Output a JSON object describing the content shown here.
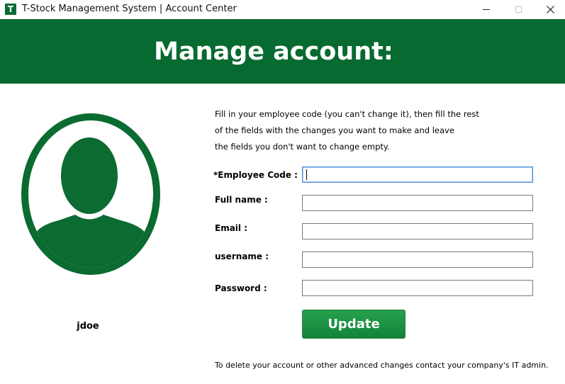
{
  "window": {
    "icon_letter": "T",
    "title": "T-Stock Management System | Account Center",
    "controls": {
      "minimize": "minimize",
      "maximize": "maximize",
      "close": "✕"
    }
  },
  "header": {
    "title": "Manage account:"
  },
  "profile": {
    "username": "jdoe",
    "avatar_icon": "user-silhouette-icon"
  },
  "instructions": [
    "Fill in your employee code (you can't change it), then fill the rest",
    "of the fields with the changes you want to make and leave",
    "the fields you don't want to change empty."
  ],
  "form": {
    "employee_code": {
      "label": "*Employee Code :",
      "value": ""
    },
    "full_name": {
      "label": "Full name :",
      "value": ""
    },
    "email": {
      "label": "Email :",
      "value": ""
    },
    "username": {
      "label": "username :",
      "value": ""
    },
    "password": {
      "label": "Password :",
      "value": ""
    },
    "update_button": "Update"
  },
  "footer": {
    "note": "To delete your account or other advanced changes contact your company's IT admin."
  },
  "colors": {
    "brand_green": "#076a30",
    "button_green": "#1a8f42",
    "focus_border": "#4a8fd6"
  }
}
